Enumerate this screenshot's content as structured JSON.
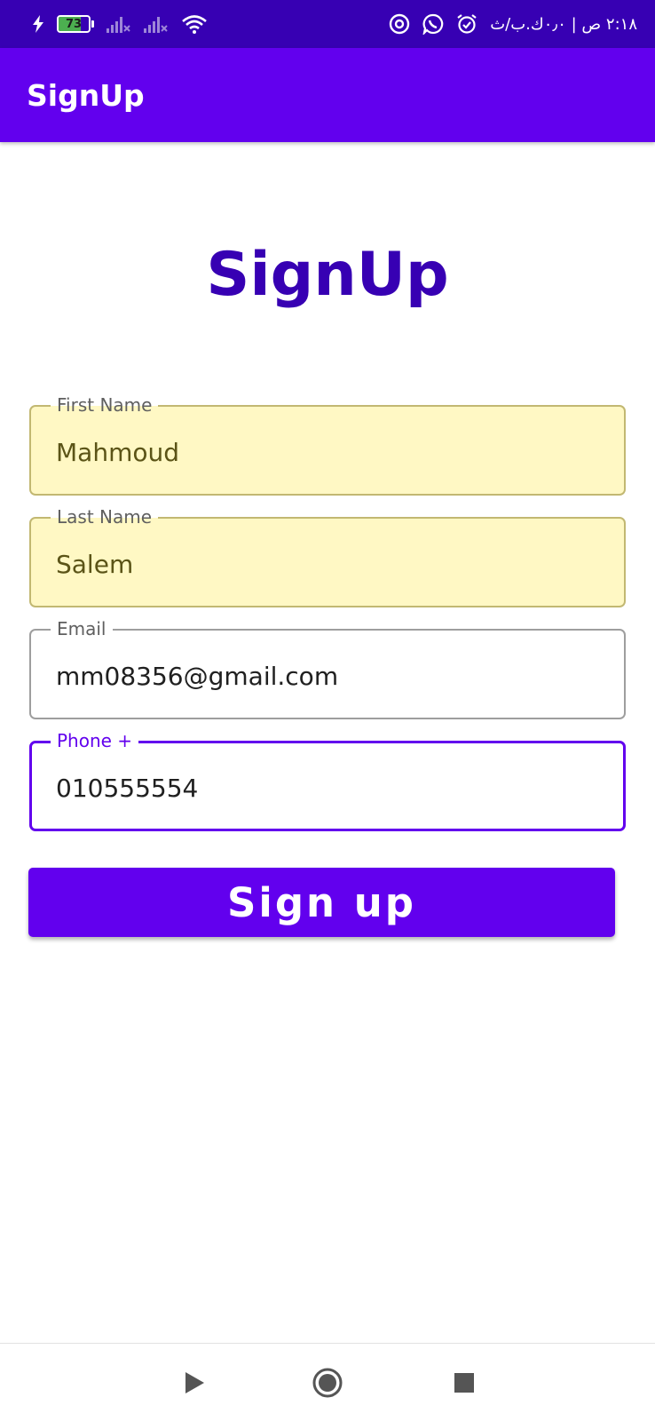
{
  "status_bar": {
    "battery_level": 73,
    "time_and_network": "٢:١٨ ص | ٠٫٠ك.ب/ث",
    "icons": [
      "charging-bolt-icon",
      "battery-icon",
      "signal-no-service-icon",
      "signal-no-service-icon",
      "wifi-icon",
      "alarm-icon",
      "whatsapp-icon",
      "at-sign-icon"
    ]
  },
  "app_bar": {
    "title": "SignUp"
  },
  "heading": "SignUp",
  "fields": [
    {
      "label": "First Name",
      "value": "Mahmoud"
    },
    {
      "label": "Last Name",
      "value": "Salem"
    },
    {
      "label": "Email",
      "value": "mm08356@gmail.com"
    },
    {
      "label": "Phone +",
      "value": "010555554"
    }
  ],
  "button": {
    "label": "Sign up"
  },
  "nav_bar": {
    "icons": [
      "back-icon",
      "home-icon",
      "recents-icon"
    ]
  },
  "colors": {
    "status_bar": "#3700b3",
    "primary": "#6200ee",
    "heading": "#3700b3",
    "autofill_background": "#fff8c4"
  }
}
